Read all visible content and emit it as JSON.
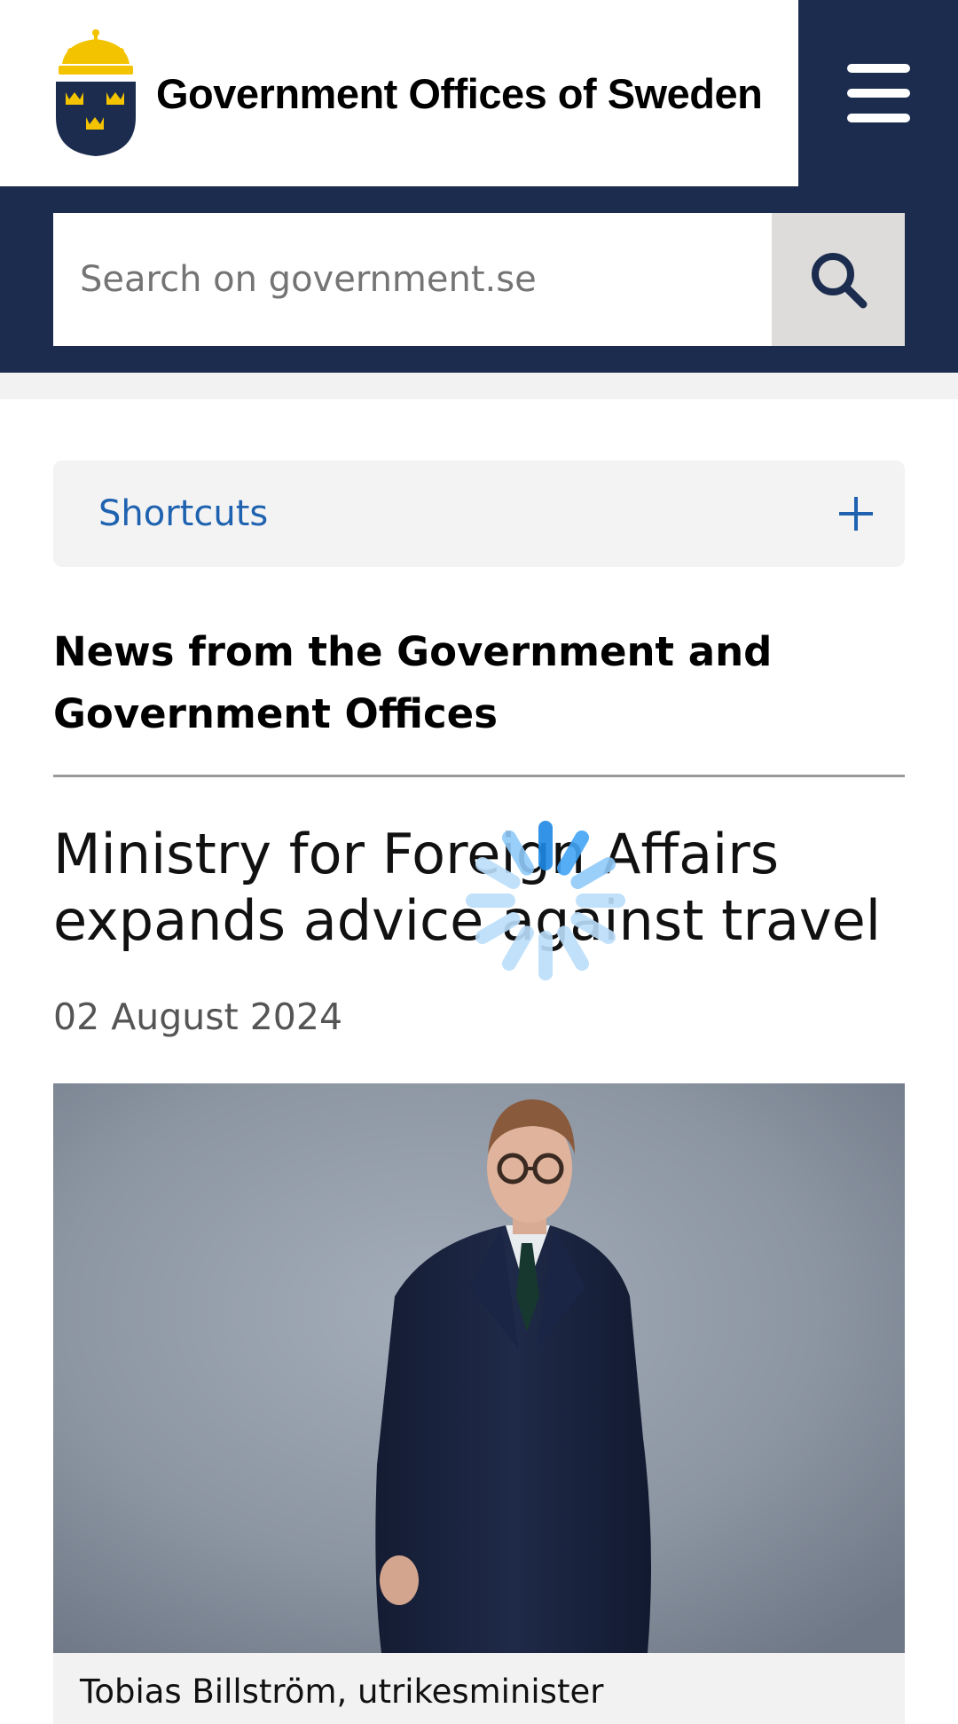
{
  "header": {
    "site_name": "Government Offices of Sweden",
    "logo_icon": "swedish-three-crowns-crest-icon",
    "menu_icon": "hamburger-menu-icon",
    "brand_color": "#1b2c4e",
    "crest_gold": "#f3c300"
  },
  "search": {
    "placeholder": "Search on government.se",
    "value": "",
    "button_icon": "search-icon"
  },
  "shortcuts": {
    "label": "Shortcuts",
    "toggle_icon": "plus-icon",
    "accent_color": "#1f63b0"
  },
  "news": {
    "heading": "News from the Government and Government Offices",
    "article": {
      "title": "Ministry for Foreign Affairs expands advice against travel",
      "date": "02 August 2024",
      "image_caption": "Tobias Billström, utrikesminister"
    }
  },
  "loading_indicator": "loading-spinner-icon"
}
